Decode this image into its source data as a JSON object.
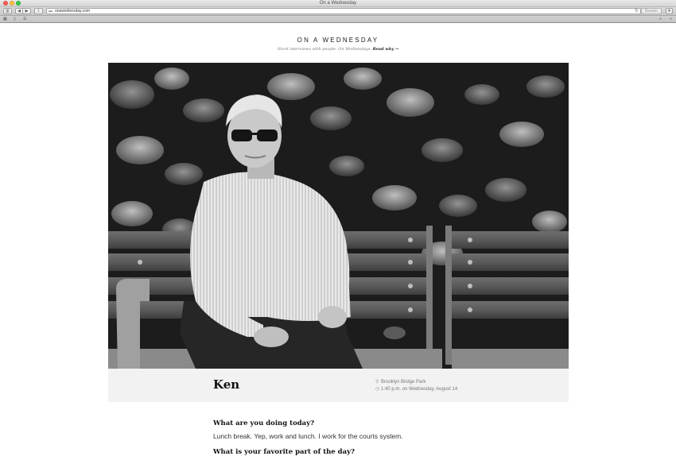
{
  "window": {
    "title": "On a Wednesday"
  },
  "toolbar": {
    "url": "onawednesday.com",
    "reader_label": "Reader",
    "icons": [
      "sidebar-icon",
      "back-icon",
      "forward-icon",
      "share-icon",
      "reload-icon",
      "extensions-icon"
    ]
  },
  "bookmarks": {
    "icons": [
      "top-sites-icon",
      "show-all-bookmarks-icon",
      "reading-list-icon",
      "more-bookmarks-icon",
      "add-bookmark-icon"
    ]
  },
  "site": {
    "title": "ON A WEDNESDAY",
    "tagline": "Short interviews with people. On Wednesdays.",
    "read_why": "Read why →"
  },
  "photo": {
    "subject": "man-on-bench-photo"
  },
  "profile": {
    "name": "Ken",
    "location": "Brooklyn Bridge Park",
    "time": "1:40 p.m. on Wednesday, August 14"
  },
  "interview": [
    {
      "question": "What are you doing today?",
      "answer": "Lunch break. Yep, work and lunch. I work for the courts system."
    },
    {
      "question": "What is your favorite part of the day?"
    }
  ]
}
